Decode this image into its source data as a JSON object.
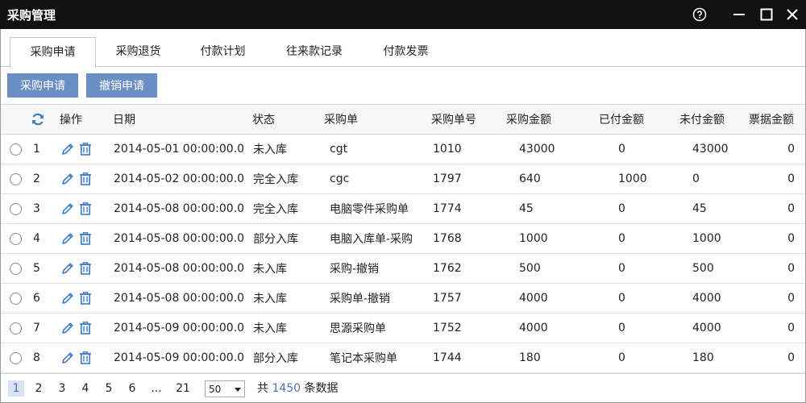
{
  "window": {
    "title": "采购管理",
    "controls": {
      "help": "help-icon",
      "minimize": "minimize-icon",
      "maximize": "maximize-icon",
      "close": "close-icon"
    }
  },
  "tabs": [
    {
      "label": "采购申请",
      "active": true
    },
    {
      "label": "采购退货"
    },
    {
      "label": "付款计划"
    },
    {
      "label": "往来款记录"
    },
    {
      "label": "付款发票"
    }
  ],
  "toolbar": {
    "apply_label": "采购申请",
    "cancel_label": "撤销申请"
  },
  "columns": [
    "操作",
    "日期",
    "状态",
    "采购单",
    "采购单号",
    "采购金额",
    "已付金额",
    "未付金额",
    "票据金额"
  ],
  "rows": [
    {
      "no": "1",
      "date": "2014-05-01 00:00:00.0",
      "status": "未入库",
      "order": "cgt",
      "order_no": "1010",
      "amount": "43000",
      "paid": "0",
      "unpaid": "43000",
      "invoice": "0"
    },
    {
      "no": "2",
      "date": "2014-05-02 00:00:00.0",
      "status": "完全入库",
      "order": "cgc",
      "order_no": "1797",
      "amount": "640",
      "paid": "1000",
      "unpaid": "0",
      "invoice": "0"
    },
    {
      "no": "3",
      "date": "2014-05-08 00:00:00.0",
      "status": "完全入库",
      "order": "电脑零件采购单",
      "order_no": "1774",
      "amount": "45",
      "paid": "0",
      "unpaid": "45",
      "invoice": "0"
    },
    {
      "no": "4",
      "date": "2014-05-08 00:00:00.0",
      "status": "部分入库",
      "order": "电脑入库单-采购",
      "order_no": "1768",
      "amount": "1000",
      "paid": "0",
      "unpaid": "1000",
      "invoice": "0"
    },
    {
      "no": "5",
      "date": "2014-05-08 00:00:00.0",
      "status": "未入库",
      "order": "采购-撤销",
      "order_no": "1762",
      "amount": "500",
      "paid": "0",
      "unpaid": "500",
      "invoice": "0"
    },
    {
      "no": "6",
      "date": "2014-05-08 00:00:00.0",
      "status": "未入库",
      "order": "采购单-撤销",
      "order_no": "1757",
      "amount": "4000",
      "paid": "0",
      "unpaid": "4000",
      "invoice": "0"
    },
    {
      "no": "7",
      "date": "2014-05-09 00:00:00.0",
      "status": "未入库",
      "order": "思源采购单",
      "order_no": "1752",
      "amount": "4000",
      "paid": "0",
      "unpaid": "4000",
      "invoice": "0"
    },
    {
      "no": "8",
      "date": "2014-05-09 00:00:00.0",
      "status": "部分入库",
      "order": "笔记本采购单",
      "order_no": "1744",
      "amount": "180",
      "paid": "0",
      "unpaid": "180",
      "invoice": "0"
    }
  ],
  "pager": {
    "pages": [
      "1",
      "2",
      "3",
      "4",
      "5",
      "6",
      "...",
      "21"
    ],
    "current": "1",
    "page_size": "50",
    "total_prefix": "共",
    "total_count": "1450",
    "total_suffix": "条数据"
  },
  "colors": {
    "titlebar": "#111111",
    "button": "#6b8ec6",
    "icon_blue": "#3d7ac8",
    "link": "#4a73b5"
  }
}
